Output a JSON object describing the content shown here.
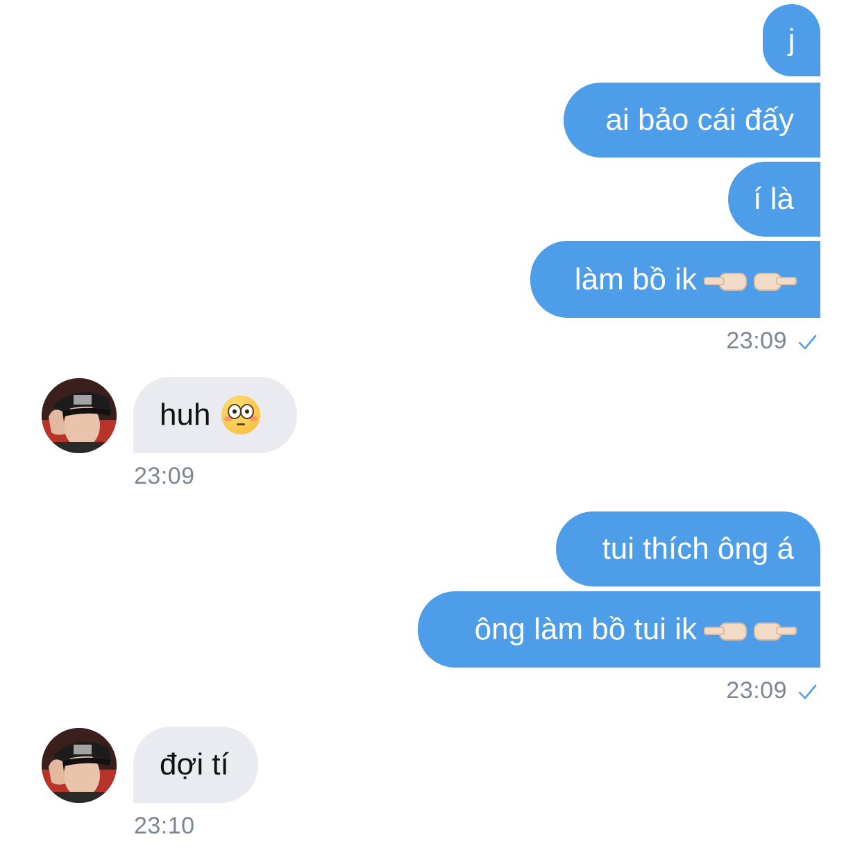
{
  "conversation": {
    "outgoing_group_1": {
      "messages": [
        "j",
        "ai bảo cái đấy",
        "í là",
        "làm bồ ik"
      ],
      "timestamp": "23:09",
      "status_icon": "single-check-icon"
    },
    "incoming_1": {
      "message": "huh",
      "emoji": "flushed-face-emoji",
      "timestamp": "23:09"
    },
    "outgoing_group_2": {
      "messages": [
        "tui thích ông á",
        "ông làm bồ tui ik"
      ],
      "timestamp": "23:09",
      "status_icon": "single-check-icon"
    },
    "incoming_2": {
      "message": "đợi tí",
      "timestamp": "23:10"
    }
  },
  "colors": {
    "outgoing_bubble": "#4d9de8",
    "incoming_bubble": "#e9ebf1",
    "timestamp": "#7a8692",
    "check": "#4d9de8"
  }
}
